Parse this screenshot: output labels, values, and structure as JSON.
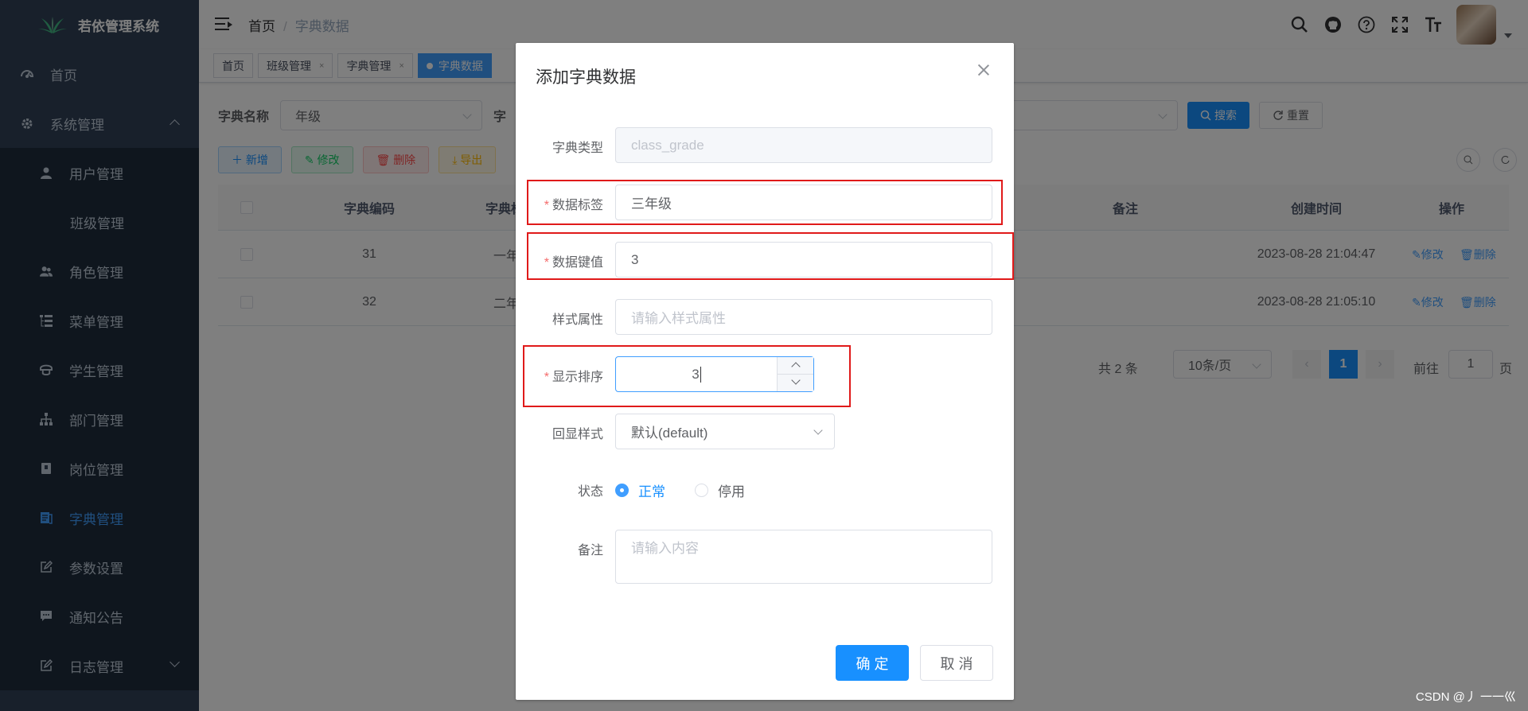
{
  "app": {
    "title": "若依管理系统"
  },
  "sidebar": {
    "items": [
      {
        "label": "首页",
        "icon": "dashboard-icon"
      },
      {
        "label": "系统管理",
        "icon": "gear-icon"
      },
      {
        "label": "用户管理",
        "icon": "user-icon"
      },
      {
        "label": "班级管理",
        "icon": ""
      },
      {
        "label": "角色管理",
        "icon": "peoples-icon"
      },
      {
        "label": "菜单管理",
        "icon": "tree-table-icon"
      },
      {
        "label": "学生管理",
        "icon": "education-icon"
      },
      {
        "label": "部门管理",
        "icon": "tree-icon"
      },
      {
        "label": "岗位管理",
        "icon": "post-icon"
      },
      {
        "label": "字典管理",
        "icon": "dict-icon"
      },
      {
        "label": "参数设置",
        "icon": "edit-icon"
      },
      {
        "label": "通知公告",
        "icon": "message-icon"
      },
      {
        "label": "日志管理",
        "icon": "log-icon"
      }
    ]
  },
  "breadcrumb": {
    "home": "首页",
    "separator": "/",
    "current": "字典数据"
  },
  "tags": [
    {
      "label": "首页",
      "closable": false
    },
    {
      "label": "班级管理",
      "closable": true
    },
    {
      "label": "字典管理",
      "closable": true
    },
    {
      "label": "字典数据",
      "closable": false
    }
  ],
  "tag_close": "×",
  "search": {
    "name_label": "字典名称",
    "name_value": "年级",
    "label2": "字",
    "search_btn": "搜索",
    "reset_btn": "重置"
  },
  "toolbar": {
    "add": "新增",
    "edit": "修改",
    "delete": "删除",
    "export": "导出"
  },
  "table": {
    "headers": {
      "code": "字典编码",
      "label": "字典标",
      "remark": "备注",
      "created": "创建时间",
      "ops": "操作"
    },
    "rows": [
      {
        "code": "31",
        "label": "一年级",
        "created": "2023-08-28 21:04:47"
      },
      {
        "code": "32",
        "label": "二年级",
        "created": "2023-08-28 21:05:10"
      }
    ],
    "edit": "修改",
    "delete": "删除"
  },
  "pagination": {
    "total": "共 2 条",
    "size": "10条/页",
    "page": "1",
    "goto": "前往",
    "goto_value": "1",
    "page_unit": "页"
  },
  "dialog": {
    "title": "添加字典数据",
    "fields": {
      "dict_type": {
        "label": "字典类型",
        "value": "class_grade"
      },
      "dict_label": {
        "label": "数据标签",
        "value": "三年级"
      },
      "dict_value": {
        "label": "数据键值",
        "value": "3"
      },
      "css_class": {
        "label": "样式属性",
        "placeholder": "请输入样式属性"
      },
      "sort": {
        "label": "显示排序",
        "value": "3"
      },
      "list_class": {
        "label": "回显样式",
        "value": "默认(default)"
      },
      "status": {
        "label": "状态",
        "options": [
          "正常",
          "停用"
        ],
        "selected": 0
      },
      "remark": {
        "label": "备注",
        "placeholder": "请输入内容"
      }
    },
    "required_mark": "*",
    "confirm": "确 定",
    "cancel": "取 消"
  },
  "colors": {
    "primary": "#1890ff",
    "sidebar_bg": "#304156",
    "highlight": "#e01a1a"
  },
  "watermark": "CSDN @丿 一一巛"
}
